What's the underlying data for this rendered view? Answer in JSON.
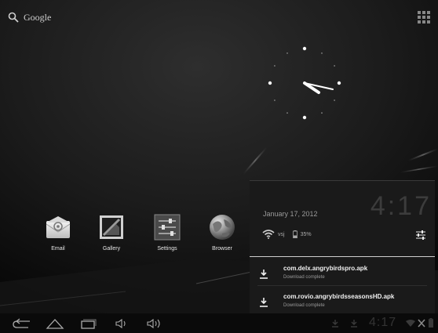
{
  "colors": {
    "background": "#000000",
    "panel": "#1a1a1a",
    "accent_text": "#f0f0f0"
  },
  "search": {
    "label": "Google",
    "icon": "search-icon"
  },
  "apps_button": {
    "icon": "apps-grid-icon"
  },
  "clock": {
    "type": "analog",
    "icon": "analog-clock-widget"
  },
  "home_apps": [
    {
      "label": "Email",
      "icon": "email-icon"
    },
    {
      "label": "Gallery",
      "icon": "gallery-icon"
    },
    {
      "label": "Settings",
      "icon": "settings-icon"
    },
    {
      "label": "Browser",
      "icon": "browser-globe-icon"
    }
  ],
  "notification_panel": {
    "date": "January 17, 2012",
    "time": "4:17",
    "wifi_label": "vsj",
    "battery_label": "35%",
    "notifications": [
      {
        "title": "com.delx.angrybirdspro.apk",
        "subtitle": "Download complete",
        "icon": "download-icon"
      },
      {
        "title": "com.rovio.angrybirdsseasonsHD.apk",
        "subtitle": "Download complete",
        "icon": "download-icon"
      }
    ]
  },
  "navbar": {
    "buttons": [
      "back-icon",
      "home-icon",
      "recent-apps-icon",
      "volume-down-icon",
      "volume-up-icon"
    ]
  },
  "system_tray": {
    "time": "4:17"
  }
}
